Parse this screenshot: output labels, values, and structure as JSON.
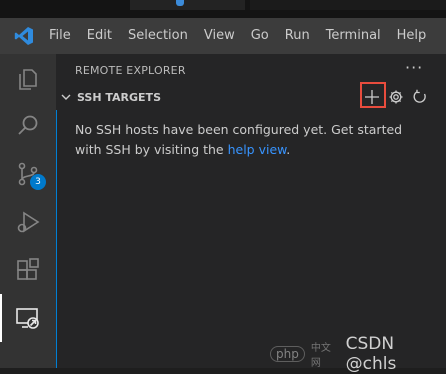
{
  "menubar": {
    "items": [
      "File",
      "Edit",
      "Selection",
      "View",
      "Go",
      "Run",
      "Terminal",
      "Help"
    ]
  },
  "activitybar": {
    "items": [
      {
        "icon": "files-icon"
      },
      {
        "icon": "search-icon"
      },
      {
        "icon": "source-control-icon",
        "badge": "3"
      },
      {
        "icon": "run-debug-icon"
      },
      {
        "icon": "extensions-icon"
      },
      {
        "icon": "remote-explorer-icon",
        "active": true
      }
    ]
  },
  "sidebar": {
    "title": "REMOTE EXPLORER",
    "more": "···",
    "section": {
      "title": "SSH TARGETS",
      "actions": [
        "add-icon",
        "gear-icon",
        "refresh-icon"
      ]
    },
    "message": {
      "text_before": "No SSH hosts have been configured yet. Get started with SSH by visiting the ",
      "link": "help view",
      "text_after": "."
    }
  },
  "watermark": {
    "logo": "php",
    "cn": "中文网",
    "text": "CSDN @chls"
  },
  "colors": {
    "accent": "#007acc",
    "link": "#3794ff",
    "highlight": "#e84c3d"
  }
}
